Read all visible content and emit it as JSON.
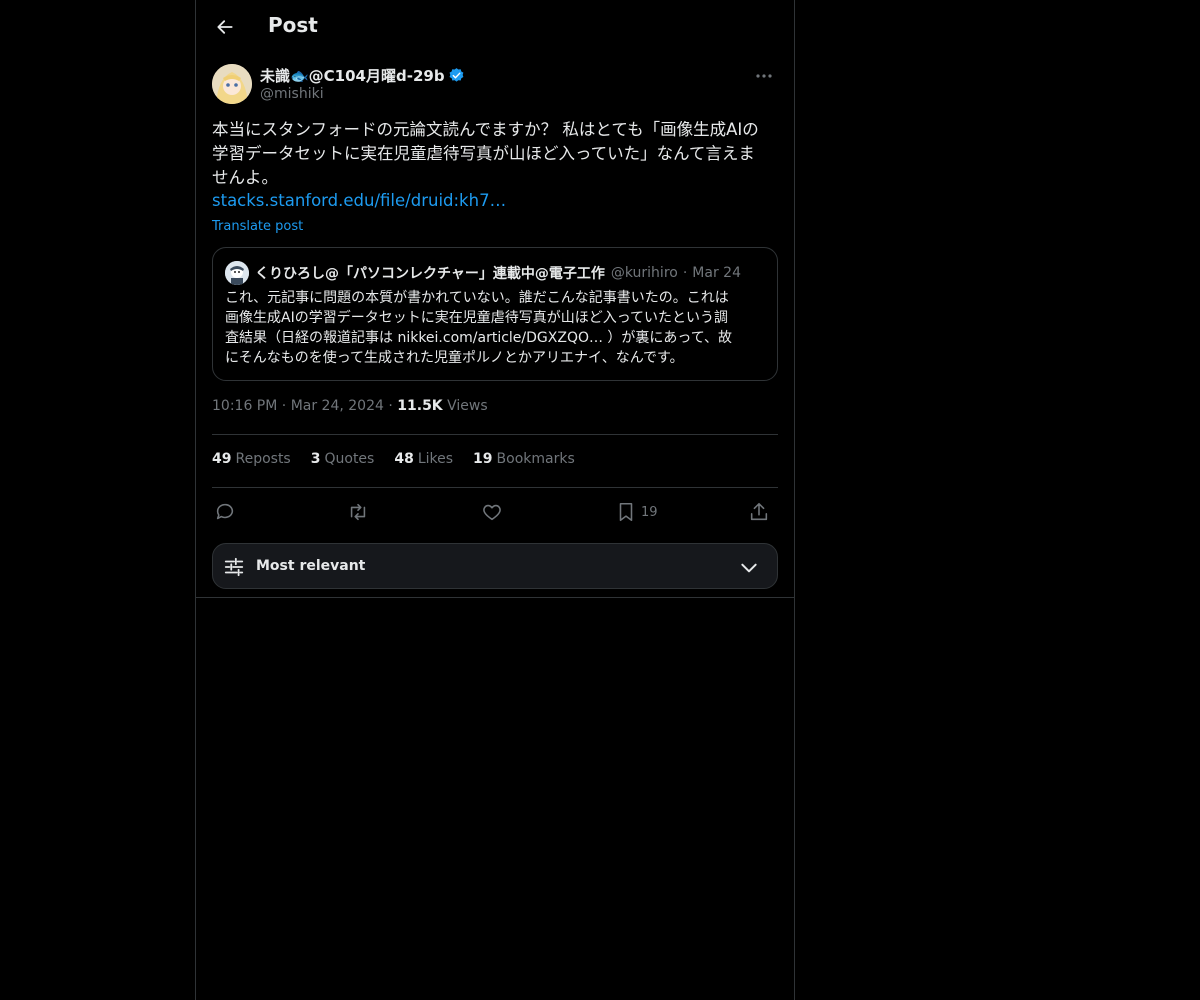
{
  "header": {
    "title": "Post"
  },
  "post": {
    "display_name": "未識🐟@C104月曜d-29b",
    "handle": "@mishiki",
    "text": "本当にスタンフォードの元論文読んでますか？ 私はとても「画像生成AIの\n学習データセットに実在児童虐待写真が山ほど入っていた」なんて言えま\nせんよ。",
    "link": "stacks.stanford.edu/file/druid:kh7…",
    "translate_label": "Translate post",
    "time": "10:16 PM",
    "date": "Mar 24, 2024",
    "views_count": "11.5K",
    "views_label": "Views"
  },
  "quote": {
    "name": "くりひろし@「パソコンレクチャー」連載中@電子工作",
    "handle": "@kurihiro",
    "dot": "·",
    "date": "Mar 24",
    "text": "これ、元記事に問題の本質が書かれていない。誰だこんな記事書いたの。これは\n画像生成AIの学習データセットに実在児童虐待写真が山ほど入っていたという調\n査結果（日経の報道記事は nikkei.com/article/DGXZQO… ）が裏にあって、故\nにそんなものを使って生成された児童ポルノとかアリエナイ、なんです。"
  },
  "stats": [
    {
      "count": "49",
      "label": "Reposts"
    },
    {
      "count": "3",
      "label": "Quotes"
    },
    {
      "count": "48",
      "label": "Likes"
    },
    {
      "count": "19",
      "label": "Bookmarks"
    }
  ],
  "actions": {
    "bookmark_count": "19"
  },
  "sort": {
    "label": "Most relevant"
  },
  "icons": [
    "back-arrow-icon",
    "verified-badge-icon",
    "more-icon",
    "reply-icon",
    "repost-icon",
    "like-icon",
    "bookmark-icon",
    "share-icon",
    "sliders-icon",
    "chevron-down-icon"
  ],
  "colors": {
    "background": "#000000",
    "text": "#e7e9ea",
    "muted": "#71767b",
    "link": "#1d9bf0",
    "border": "#2f3336"
  }
}
